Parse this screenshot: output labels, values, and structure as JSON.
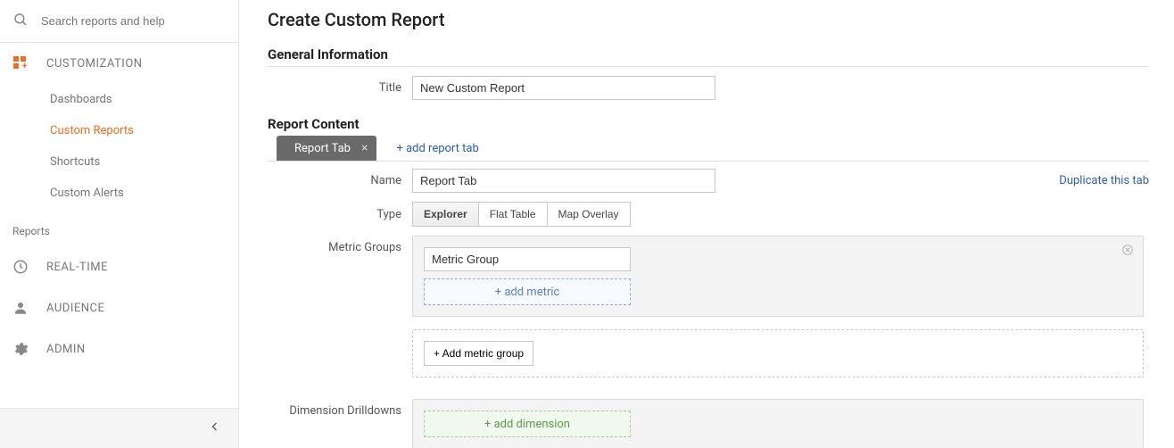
{
  "search": {
    "placeholder": "Search reports and help"
  },
  "sidebar": {
    "customization_label": "CUSTOMIZATION",
    "items": [
      "Dashboards",
      "Custom Reports",
      "Shortcuts",
      "Custom Alerts"
    ],
    "reports_label": "Reports",
    "realtime_label": "REAL-TIME",
    "audience_label": "AUDIENCE",
    "admin_label": "ADMIN"
  },
  "page": {
    "title": "Create Custom Report",
    "general_info": "General Information",
    "title_label": "Title",
    "title_value": "New Custom Report",
    "report_content": "Report Content",
    "tab_chip": "Report Tab",
    "add_tab": "+ add report tab",
    "name_label": "Name",
    "name_value": "Report Tab",
    "dup_link": "Duplicate this tab",
    "type_label": "Type",
    "types": [
      "Explorer",
      "Flat Table",
      "Map Overlay"
    ],
    "metric_groups_label": "Metric Groups",
    "metric_group_value": "Metric Group",
    "add_metric": "+ add metric",
    "add_metric_group": "+ Add metric group",
    "dim_label": "Dimension Drilldowns",
    "add_dimension": "+ add dimension"
  }
}
